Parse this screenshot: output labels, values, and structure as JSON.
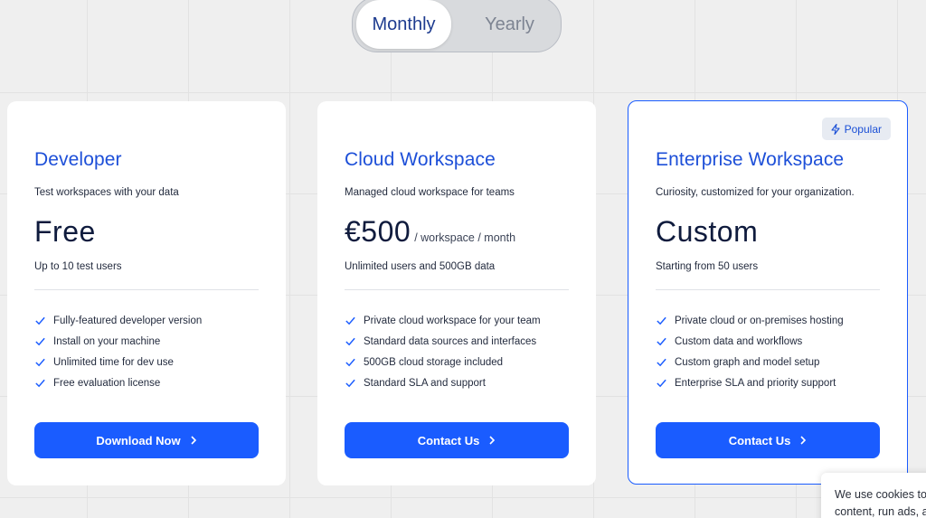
{
  "billing_toggle": {
    "monthly": "Monthly",
    "yearly": "Yearly",
    "selected": "Monthly"
  },
  "plans": [
    {
      "title": "Developer",
      "subtitle": "Test workspaces with your data",
      "price": "Free",
      "price_unit": "",
      "price_note": "Up to 10 test users",
      "features": [
        "Fully-featured developer version",
        "Install on your machine",
        "Unlimited time for dev use",
        "Free evaluation license"
      ],
      "cta": "Download Now"
    },
    {
      "title": "Cloud Workspace",
      "subtitle": "Managed cloud workspace for teams",
      "price": "€500",
      "price_unit": "/ workspace / month",
      "price_note": "Unlimited users and 500GB data",
      "features": [
        "Private cloud workspace for your team",
        "Standard data sources and interfaces",
        "500GB cloud storage included",
        "Standard SLA and support"
      ],
      "cta": "Contact Us"
    },
    {
      "title": "Enterprise Workspace",
      "badge": "Popular",
      "subtitle": "Curiosity, customized for your organization.",
      "price": "Custom",
      "price_unit": "",
      "price_note": "Starting from 50 users",
      "features": [
        "Private cloud or on-premises hosting",
        "Custom data and workflows",
        "Custom graph and model setup",
        "Enterprise SLA and priority support"
      ],
      "cta": "Contact Us"
    }
  ],
  "cookie_banner": {
    "line1": "We use cookies to",
    "line2": "content, run ads, a"
  },
  "colors": {
    "accent": "#1a5cff",
    "title": "#1d4fd8",
    "background": "#efefef"
  },
  "icons": {
    "feature": "check-icon",
    "cta": "chevron-right-icon",
    "badge": "lightning-icon"
  }
}
